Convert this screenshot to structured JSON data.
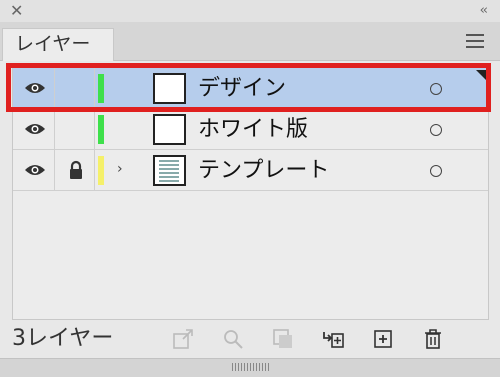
{
  "panel": {
    "close_glyph": "✕",
    "collapse_glyph": "‹‹",
    "tab_label": "レイヤー",
    "menu_icon": "hamburger-menu-icon"
  },
  "layers": [
    {
      "name": "デザイン",
      "color": "#3ee04b",
      "visible": true,
      "locked": false,
      "expandable": false,
      "selected": true,
      "thumb": "blank"
    },
    {
      "name": "ホワイト版",
      "color": "#3ee04b",
      "visible": true,
      "locked": false,
      "expandable": false,
      "selected": false,
      "thumb": "blank"
    },
    {
      "name": "テンプレート",
      "color": "#f5f06a",
      "visible": true,
      "locked": true,
      "expandable": true,
      "selected": false,
      "thumb": "image"
    }
  ],
  "footer": {
    "count_label": "3レイヤー",
    "icons": [
      "export-icon",
      "search-icon",
      "clipping-mask-icon",
      "new-sublayer-icon",
      "new-layer-icon",
      "trash-icon"
    ]
  },
  "colors": {
    "selection": "#b6cdec",
    "highlight": "#e0201f"
  }
}
